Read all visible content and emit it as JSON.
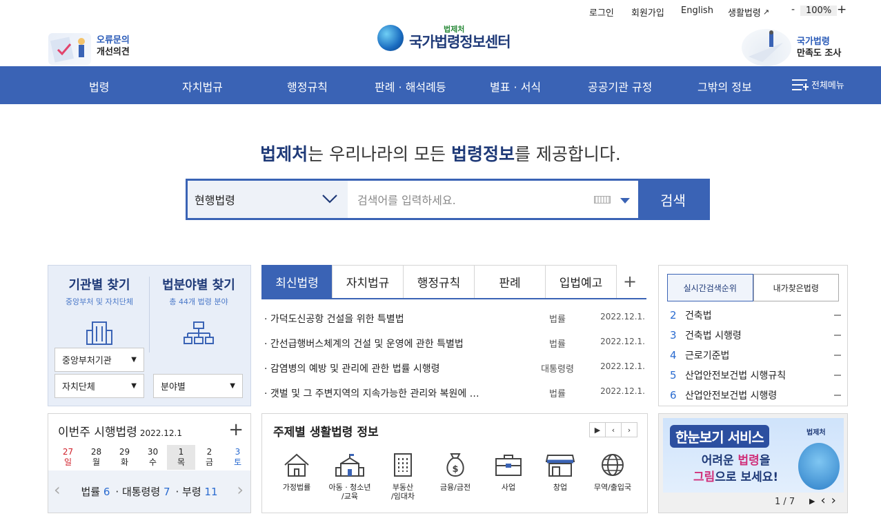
{
  "util": {
    "login": "로그인",
    "join": "회원가입",
    "english": "English",
    "life_law": "생활법령",
    "zoom_minus": "-",
    "zoom_pct": "100%",
    "zoom_plus": "+"
  },
  "header": {
    "err_l1": "오류문의",
    "err_l2": "개선의견",
    "logo_sub": "법제처",
    "logo_main": "국가법령정보센터",
    "survey_l1": "국가법령",
    "survey_l2": "만족도 조사"
  },
  "nav": {
    "items": [
      "법령",
      "자치법규",
      "행정규칙",
      "판례 · 해석례등",
      "별표 · 서식",
      "공공기관 규정",
      "그밖의 정보"
    ],
    "all_menu": "전체메뉴"
  },
  "hero": {
    "b1": "법제처",
    "t1": "는 우리나라의 모든 ",
    "b2": "법령정보",
    "t2": "를 제공합니다."
  },
  "search": {
    "scope": "현행법령",
    "placeholder": "검색어를 입력하세요.",
    "button": "검색"
  },
  "finder": {
    "org_title": "기관별 찾기",
    "org_sub": "중앙부처 및 자치단체",
    "field_title": "법분야별 찾기",
    "field_sub": "총 44개 법령 분야",
    "drop_central": "중앙부처기관",
    "drop_local": "자치단체",
    "drop_field": "분야별"
  },
  "tabs": {
    "items": [
      "최신법령",
      "자치법규",
      "행정규칙",
      "판례",
      "입법예고"
    ],
    "plus": "+"
  },
  "laws": [
    {
      "title": "· 가덕도신공항 건설을 위한 특별법",
      "kind": "법률",
      "date": "2022.12.1."
    },
    {
      "title": "· 간선급행버스체계의 건설 및 운영에 관한 특별법",
      "kind": "법률",
      "date": "2022.12.1."
    },
    {
      "title": "· 감염병의 예방 및 관리에 관한 법률 시행령",
      "kind": "대통령령",
      "date": "2022.12.1."
    },
    {
      "title": "· 갯벌 및 그 주변지역의 지속가능한 관리와 복원에 …",
      "kind": "법률",
      "date": "2022.12.1."
    }
  ],
  "rank": {
    "tab_live": "실시간검색순위",
    "tab_mine": "내가찾은법령",
    "items": [
      {
        "n": "2",
        "t": "건축법"
      },
      {
        "n": "3",
        "t": "건축법 시행령"
      },
      {
        "n": "4",
        "t": "근로기준법"
      },
      {
        "n": "5",
        "t": "산업안전보건법 시행규칙"
      },
      {
        "n": "6",
        "t": "산업안전보건법 시행령"
      }
    ]
  },
  "weekly": {
    "title": "이번주 시행법령",
    "date": "2022.12.1",
    "plus": "+",
    "days": [
      {
        "d": "27",
        "w": "일"
      },
      {
        "d": "28",
        "w": "월"
      },
      {
        "d": "29",
        "w": "화"
      },
      {
        "d": "30",
        "w": "수"
      },
      {
        "d": "1",
        "w": "목"
      },
      {
        "d": "2",
        "w": "금"
      },
      {
        "d": "3",
        "w": "토"
      }
    ],
    "law_label": "법률",
    "law_count": "6",
    "pres_label": "· 대통령령",
    "pres_count": "7",
    "min_label": "· 부령",
    "min_count": "11",
    "prev": "‹",
    "next": "›"
  },
  "topics": {
    "title": "주제별 생활법령 정보",
    "play": "▶",
    "prev": "‹",
    "next": "›",
    "items": [
      {
        "l1": "가정법률",
        "l2": ""
      },
      {
        "l1": "아동 · 청소년",
        "l2": "/교육"
      },
      {
        "l1": "부동산",
        "l2": "/임대차"
      },
      {
        "l1": "금융/금전",
        "l2": ""
      },
      {
        "l1": "사업",
        "l2": ""
      },
      {
        "l1": "창업",
        "l2": ""
      },
      {
        "l1": "무역/출입국",
        "l2": ""
      }
    ]
  },
  "banner": {
    "t1": "한눈보기 서비스",
    "logo": "법제처",
    "l1a": "어려운 ",
    "l1b": "법령",
    "l1c": "을",
    "l2a": "그림",
    "l2b": "으로 보세요!",
    "page": "1 / 7",
    "play": "▶",
    "prev": "‹",
    "next": "›"
  },
  "colors": {
    "brand": "#3a63b5",
    "navy": "#1f3a78",
    "sunday": "#d0202a",
    "saturday": "#2a6bd0"
  }
}
